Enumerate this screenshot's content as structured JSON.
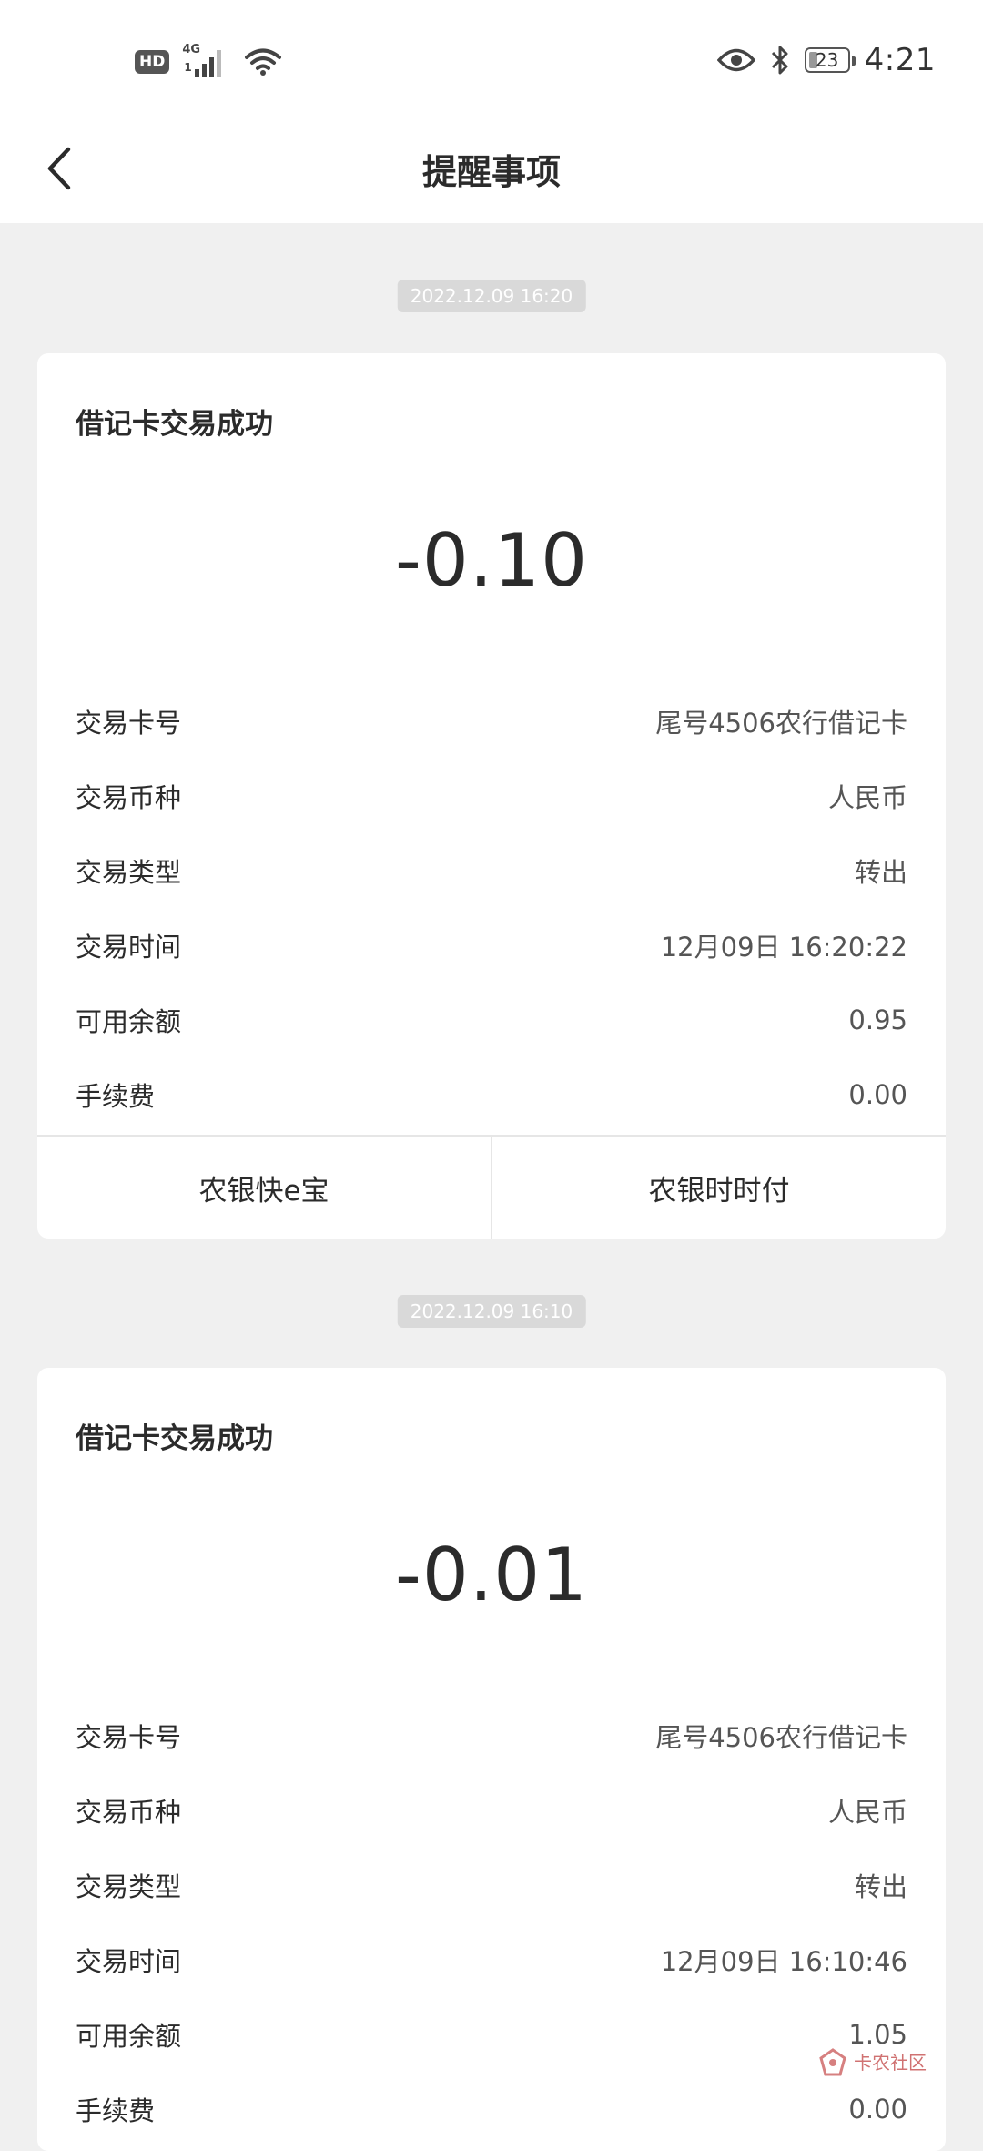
{
  "status_bar": {
    "hd": "HD",
    "network": "4G",
    "sim": "1",
    "battery": "23",
    "time": "4:21"
  },
  "header": {
    "title": "提醒事项"
  },
  "messages": [
    {
      "timestamp": "2022.12.09 16:20",
      "title": "借记卡交易成功",
      "amount": "-0.10",
      "rows": [
        {
          "label": "交易卡号",
          "value": "尾号4506农行借记卡"
        },
        {
          "label": "交易币种",
          "value": "人民币"
        },
        {
          "label": "交易类型",
          "value": "转出"
        },
        {
          "label": "交易时间",
          "value": "12月09日 16:20:22"
        },
        {
          "label": "可用余额",
          "value": "0.95"
        },
        {
          "label": "手续费",
          "value": "0.00"
        }
      ],
      "actions": [
        "农银快e宝",
        "农银时时付"
      ]
    },
    {
      "timestamp": "2022.12.09 16:10",
      "title": "借记卡交易成功",
      "amount": "-0.01",
      "rows": [
        {
          "label": "交易卡号",
          "value": "尾号4506农行借记卡"
        },
        {
          "label": "交易币种",
          "value": "人民币"
        },
        {
          "label": "交易类型",
          "value": "转出"
        },
        {
          "label": "交易时间",
          "value": "12月09日 16:10:46"
        },
        {
          "label": "可用余额",
          "value": "1.05"
        },
        {
          "label": "手续费",
          "value": "0.00"
        }
      ]
    }
  ],
  "watermark": {
    "text": "卡农社区"
  }
}
